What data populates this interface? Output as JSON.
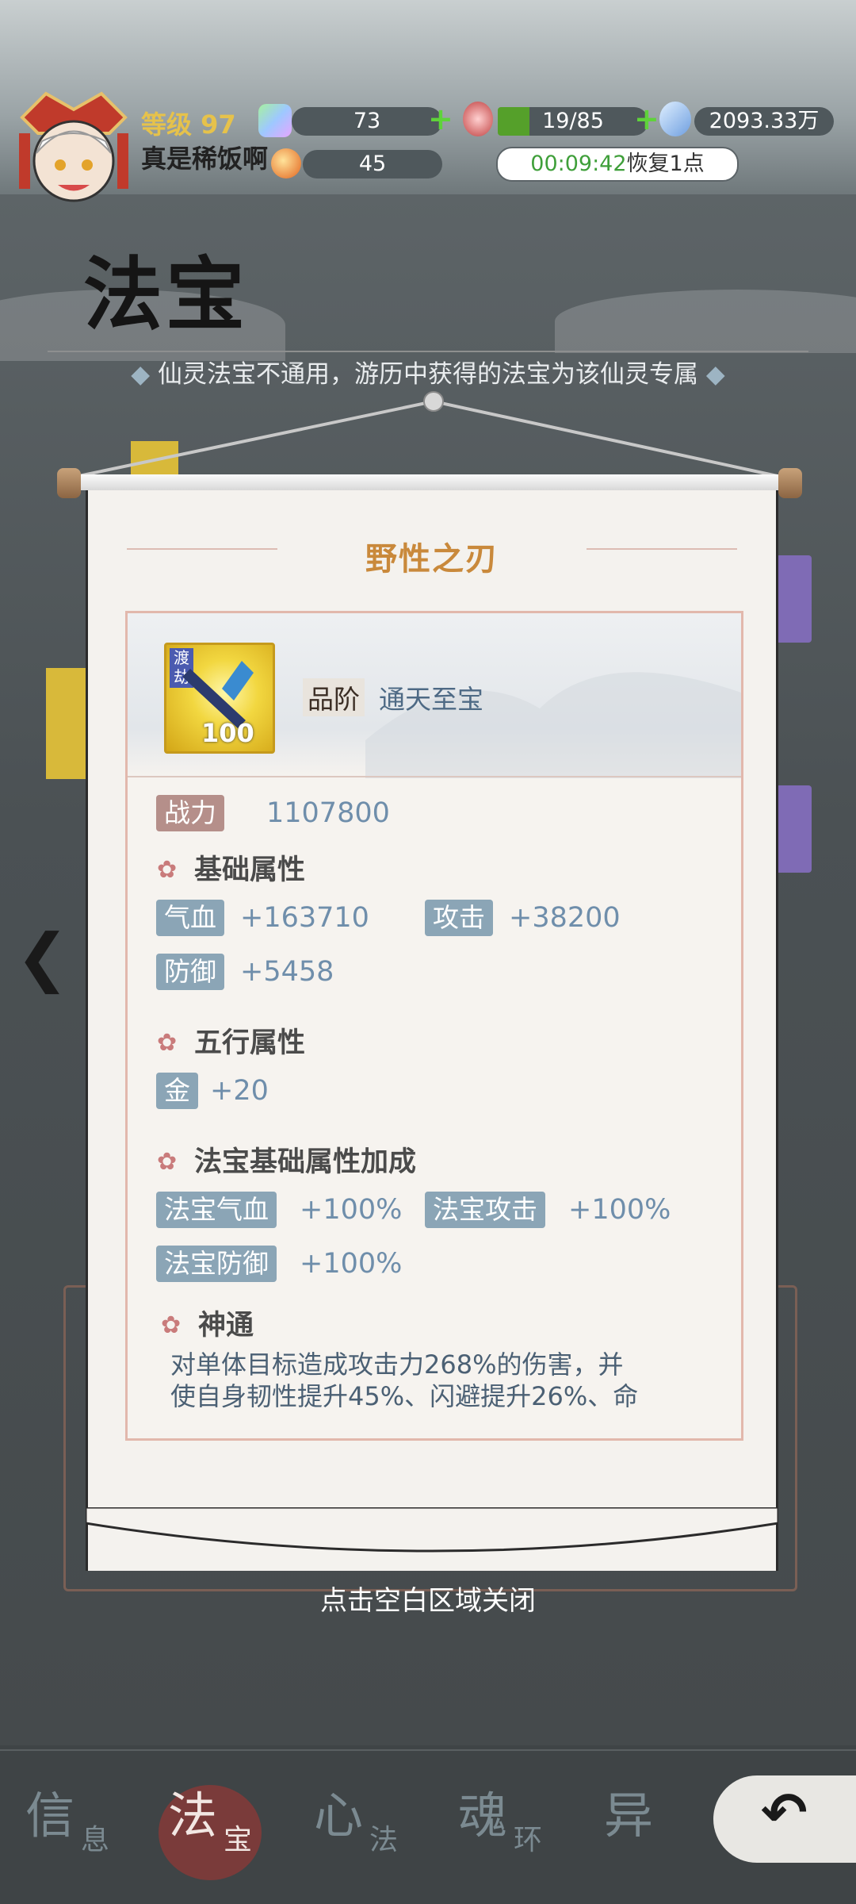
{
  "player": {
    "level_label": "等级 97",
    "name": "真是稀饭啊"
  },
  "resources": {
    "gems": "73",
    "stamina": "19/85",
    "money": "2093.33万",
    "orbs": "45",
    "timer": "00:09:42",
    "timer_suffix": "恢复1点"
  },
  "page": {
    "title": "法宝",
    "notice": "仙灵法宝不通用，游历中获得的法宝为该仙灵专属"
  },
  "item": {
    "name": "野性之刃",
    "badge": "渡劫",
    "level": "100",
    "grade_label": "品阶",
    "grade_value": "通天至宝",
    "power_label": "战力",
    "power_value": "1107800",
    "base_section": "基础属性",
    "base_stats": [
      {
        "label": "气血",
        "value": "+163710"
      },
      {
        "label": "攻击",
        "value": "+38200"
      },
      {
        "label": "防御",
        "value": "+5458"
      }
    ],
    "element_section": "五行属性",
    "element_stats": [
      {
        "label": "金",
        "value": "+20"
      }
    ],
    "bonus_section": "法宝基础属性加成",
    "bonus_stats": [
      {
        "label": "法宝气血",
        "value": "+100%"
      },
      {
        "label": "法宝攻击",
        "value": "+100%"
      },
      {
        "label": "法宝防御",
        "value": "+100%"
      }
    ],
    "skill_section": "神通",
    "skill_desc_line1": "对单体目标造成攻击力268%的伤害，并",
    "skill_desc_line2": "使自身韧性提升45%、闪避提升26%、命"
  },
  "close_hint": "点击空白区域关闭",
  "tabs": [
    {
      "main": "信",
      "sub": "息"
    },
    {
      "main": "法",
      "sub": "宝"
    },
    {
      "main": "心",
      "sub": "法"
    },
    {
      "main": "魂",
      "sub": "环"
    },
    {
      "main": "异",
      "sub": ""
    }
  ],
  "colors": {
    "accent": "#c9893b",
    "tag_bg": "#8ba5b6",
    "value_text": "#6f8eab",
    "stamina_bar": "#55a02a"
  }
}
